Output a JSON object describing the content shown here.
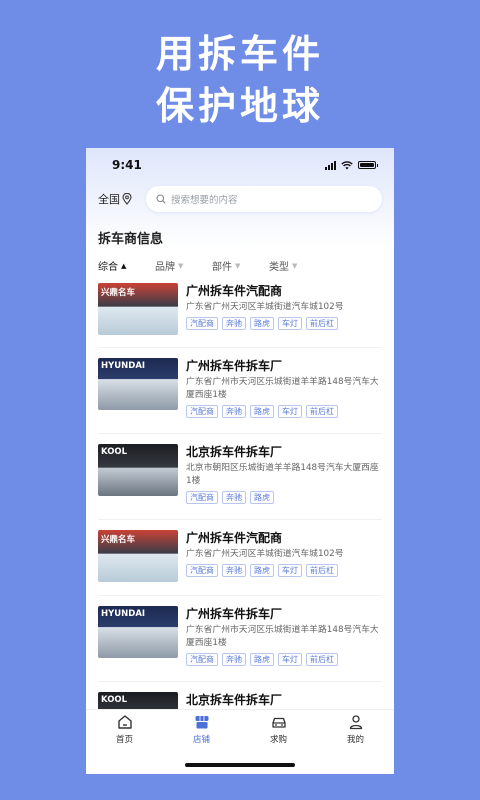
{
  "promo": {
    "line1": "用拆车件",
    "line2": "保护地球"
  },
  "status": {
    "time": "9:41"
  },
  "search": {
    "region": "全国",
    "placeholder": "搜索想要的内容"
  },
  "section_title": "拆车商信息",
  "filters": [
    {
      "label": "综合",
      "active": true
    },
    {
      "label": "品牌",
      "active": false
    },
    {
      "label": "部件",
      "active": false
    },
    {
      "label": "类型",
      "active": false
    }
  ],
  "listings": [
    {
      "thumb_label": "兴鼎名车",
      "name": "广州拆车件汽配商",
      "address": "广东省广州天河区羊城街道汽车城102号",
      "tags": [
        "汽配商",
        "奔驰",
        "路虎",
        "车灯",
        "前后杠"
      ]
    },
    {
      "thumb_label": "HYUNDAI",
      "name": "广州拆车件拆车厂",
      "address": "广东省广州市天河区乐城街道羊羊路148号汽车大厦西座1楼",
      "tags": [
        "汽配商",
        "奔驰",
        "路虎",
        "车灯",
        "前后杠"
      ]
    },
    {
      "thumb_label": "KOOL",
      "name": "北京拆车件拆车厂",
      "address": "北京市朝阳区乐城街道羊羊路148号汽车大厦西座1楼",
      "tags": [
        "汽配商",
        "奔驰",
        "路虎"
      ]
    },
    {
      "thumb_label": "兴鼎名车",
      "name": "广州拆车件汽配商",
      "address": "广东省广州天河区羊城街道汽车城102号",
      "tags": [
        "汽配商",
        "奔驰",
        "路虎",
        "车灯",
        "前后杠"
      ]
    },
    {
      "thumb_label": "HYUNDAI",
      "name": "广州拆车件拆车厂",
      "address": "广东省广州市天河区乐城街道羊羊路148号汽车大厦西座1楼",
      "tags": [
        "汽配商",
        "奔驰",
        "路虎",
        "车灯",
        "前后杠"
      ]
    },
    {
      "thumb_label": "KOOL",
      "name": "北京拆车件拆车厂",
      "address": "",
      "tags": []
    }
  ],
  "tabbar": [
    {
      "label": "首页",
      "icon": "home-icon",
      "active": false
    },
    {
      "label": "店铺",
      "icon": "store-icon",
      "active": true
    },
    {
      "label": "求购",
      "icon": "car-icon",
      "active": false
    },
    {
      "label": "我的",
      "icon": "user-icon",
      "active": false
    }
  ],
  "colors": {
    "background": "#6f8de6",
    "accent": "#4c6fd8",
    "tag_text": "#5a7bd8"
  }
}
